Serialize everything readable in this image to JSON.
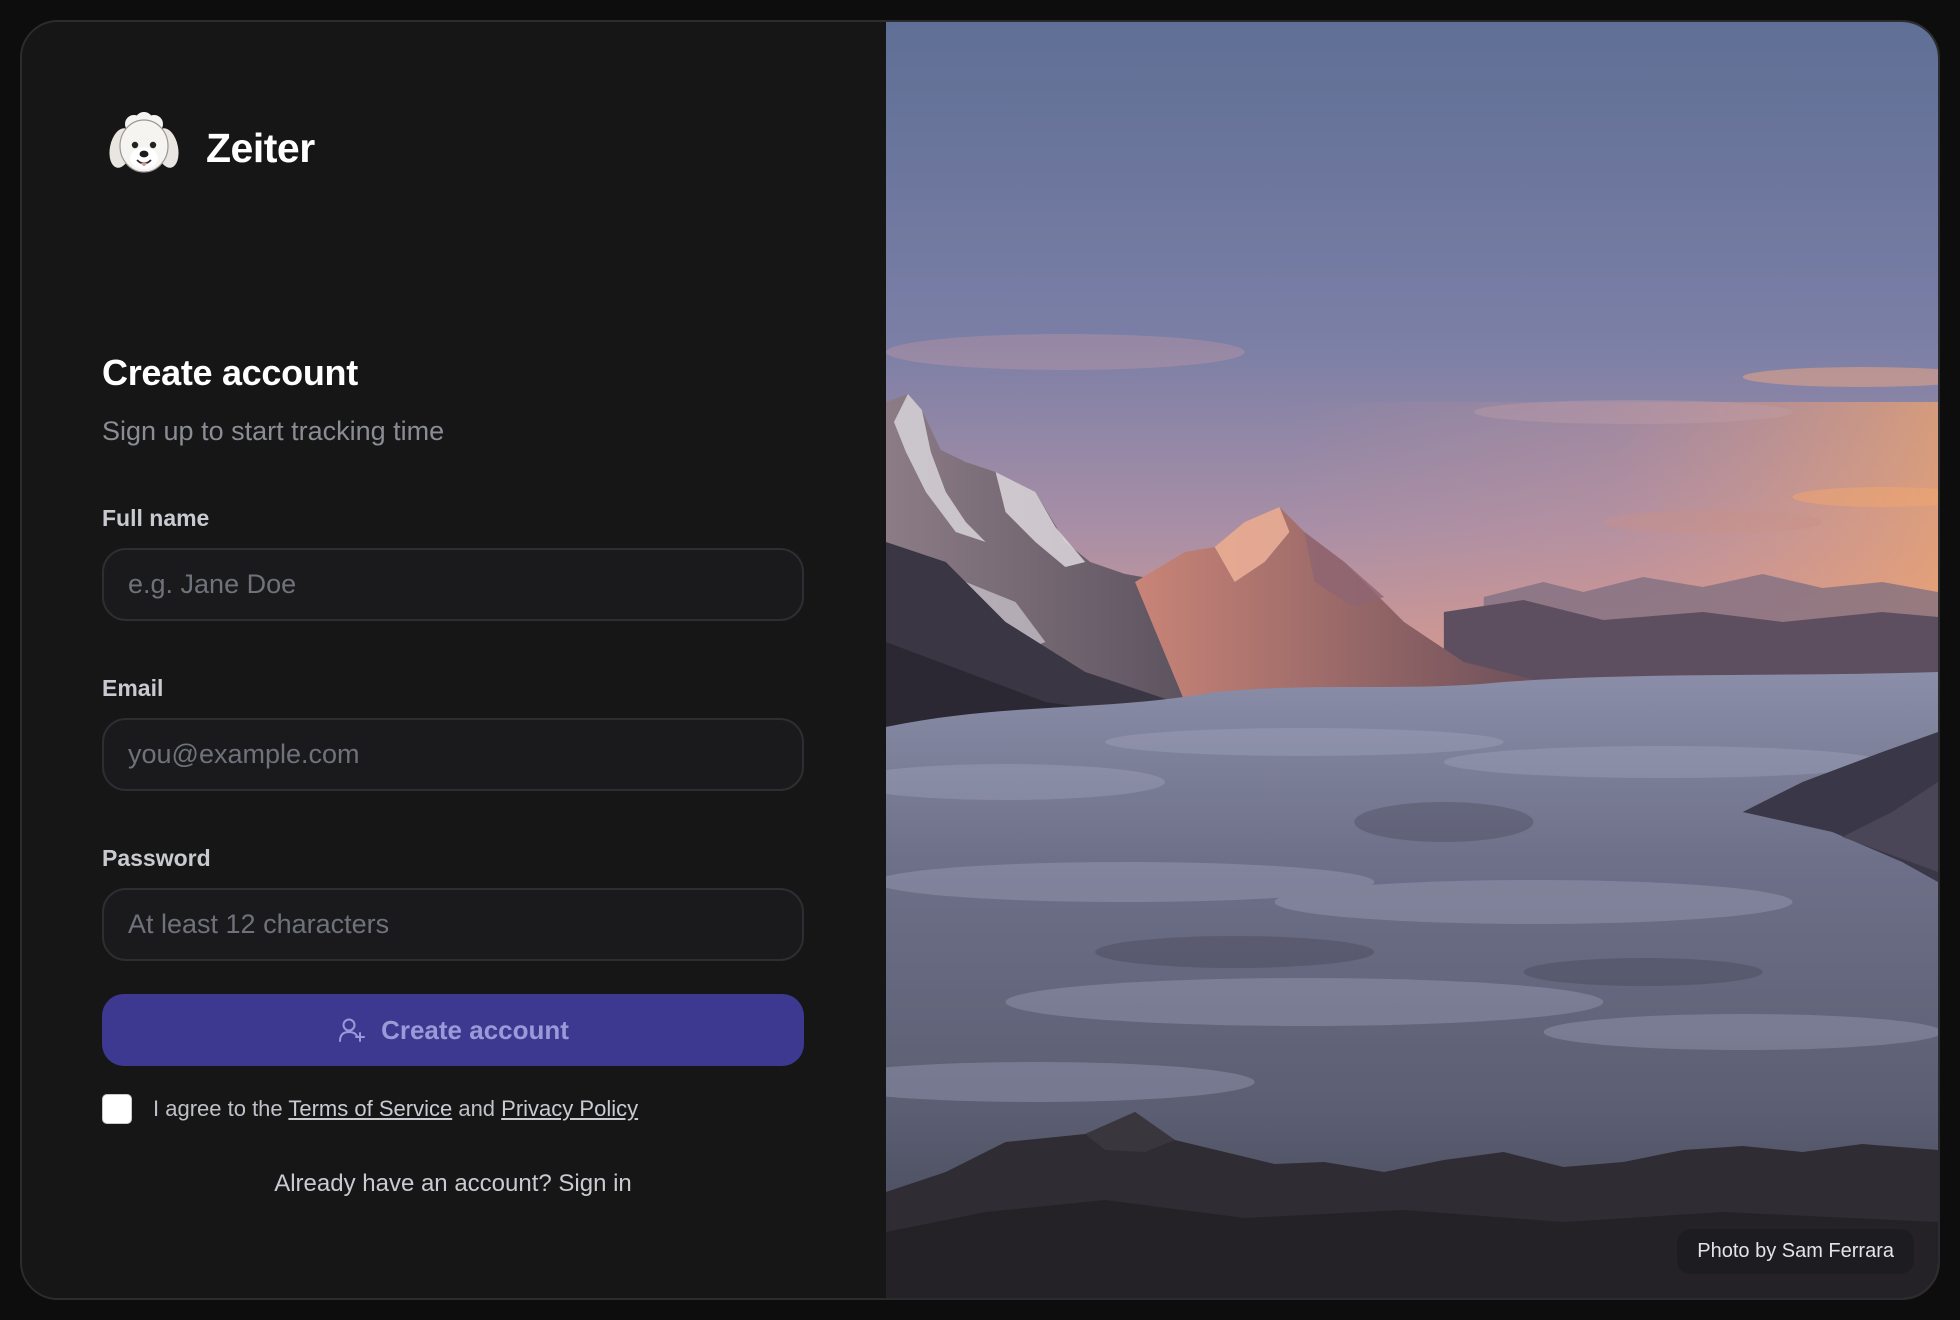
{
  "brand": {
    "name": "Zeiter",
    "logo_icon": "dog-face-logo-icon"
  },
  "form": {
    "title": "Create account",
    "subtitle": "Sign up to start tracking time",
    "fields": [
      {
        "label": "Full name",
        "placeholder": "e.g. Jane Doe",
        "value": ""
      },
      {
        "label": "Email",
        "placeholder": "you@example.com",
        "value": ""
      },
      {
        "label": "Password",
        "placeholder": "At least 12 characters",
        "value": ""
      }
    ],
    "submit_label": "Create account",
    "submit_icon": "user-plus-icon",
    "agreement": {
      "checked": false,
      "prefix": "I agree to the",
      "terms_link": "Terms of Service",
      "conjunction": "and",
      "privacy_link": "Privacy Policy"
    },
    "signin_prompt": "Already have an account? Sign in"
  },
  "photo": {
    "credit": "Photo by Sam Ferrara"
  },
  "colors": {
    "background": "#161617",
    "accent": "#3d3991",
    "accent_text": "#9a9ad8",
    "input_border": "#2d2e31"
  }
}
